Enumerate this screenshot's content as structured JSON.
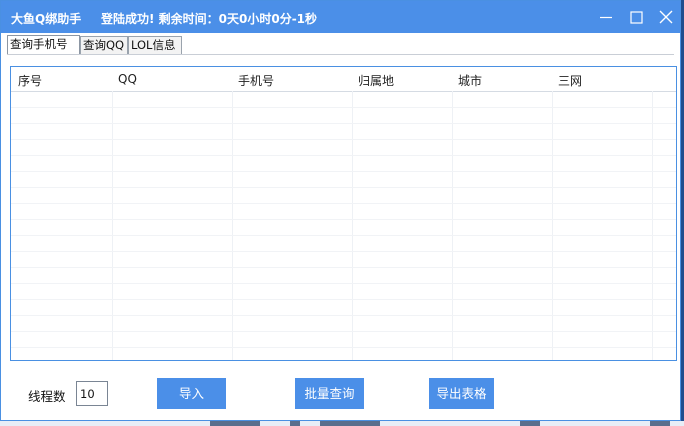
{
  "titlebar": {
    "app_title": "大鱼Q绑助手",
    "status_text": "登陆成功! 剩余时间：0天0小时0分-1秒"
  },
  "tabs": [
    {
      "label": "查询手机号",
      "active": true
    },
    {
      "label": "查询QQ",
      "active": false
    },
    {
      "label": "LOL信息",
      "active": false
    }
  ],
  "table": {
    "columns": [
      "序号",
      "QQ",
      "手机号",
      "归属地",
      "城市",
      "三网"
    ],
    "rows": []
  },
  "controls": {
    "thread_label": "线程数",
    "thread_value": "10",
    "import_label": "导入",
    "batch_query_label": "批量查询",
    "export_label": "导出表格"
  },
  "colors": {
    "titlebar": "#4b8fe8",
    "accent": "#4a90e2",
    "button": "#4b8fe8"
  }
}
